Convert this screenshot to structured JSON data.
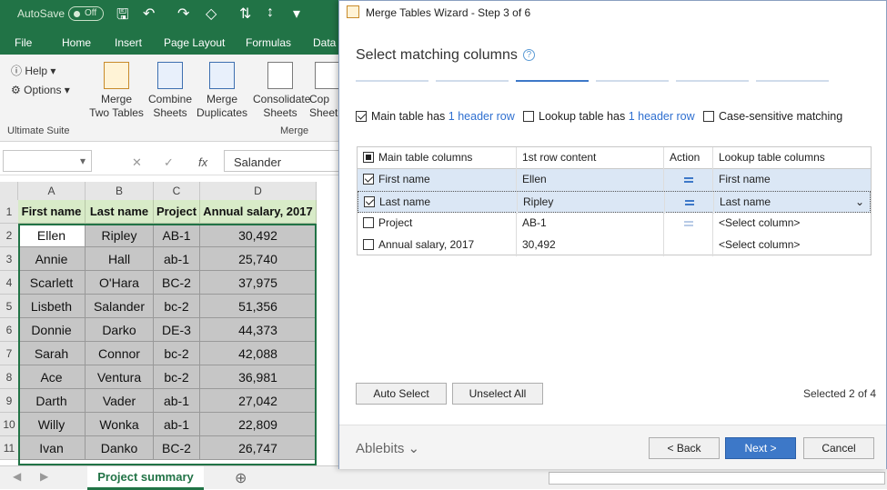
{
  "excel": {
    "autosave_label": "AutoSave",
    "autosave_state": "Off",
    "tabs": [
      "File",
      "Home",
      "Insert",
      "Page Layout",
      "Formulas",
      "Data"
    ],
    "ribbon": {
      "help_label": "Help",
      "options_label": "Options",
      "suite_label": "Ultimate Suite",
      "merge_group_label": "Merge",
      "buttons": [
        {
          "line1": "Merge",
          "line2": "Two Tables"
        },
        {
          "line1": "Combine",
          "line2": "Sheets"
        },
        {
          "line1": "Merge",
          "line2": "Duplicates"
        },
        {
          "line1": "Consolidate",
          "line2": "Sheets"
        },
        {
          "line1": "Cop",
          "line2": "Sheet"
        }
      ]
    },
    "formula": {
      "fx": "fx",
      "value": "Salander"
    },
    "columns": [
      "A",
      "B",
      "C",
      "D"
    ],
    "rows": [
      "1",
      "2",
      "3",
      "4",
      "5",
      "6",
      "7",
      "8",
      "9",
      "10",
      "11"
    ],
    "header": [
      "First name",
      "Last name",
      "Project",
      "Annual salary, 2017"
    ],
    "data": [
      [
        "Ellen",
        "Ripley",
        "AB-1",
        "30,492"
      ],
      [
        "Annie",
        "Hall",
        "ab-1",
        "25,740"
      ],
      [
        "Scarlett",
        "O'Hara",
        "BC-2",
        "37,975"
      ],
      [
        "Lisbeth",
        "Salander",
        "bc-2",
        "51,356"
      ],
      [
        "Donnie",
        "Darko",
        "DE-3",
        "44,373"
      ],
      [
        "Sarah",
        "Connor",
        "bc-2",
        "42,088"
      ],
      [
        "Ace",
        "Ventura",
        "bc-2",
        "36,981"
      ],
      [
        "Darth",
        "Vader",
        "ab-1",
        "27,042"
      ],
      [
        "Willy",
        "Wonka",
        "ab-1",
        "22,809"
      ],
      [
        "Ivan",
        "Danko",
        "BC-2",
        "26,747"
      ]
    ],
    "sheet_tab": "Project summary"
  },
  "wizard": {
    "title": "Merge Tables Wizard - Step 3 of 6",
    "heading": "Select matching columns",
    "options": {
      "main_prefix": "Main table has",
      "main_link": "1 header row",
      "lookup_prefix": "Lookup table has",
      "lookup_link": "1 header row",
      "case_label": "Case-sensitive matching"
    },
    "table": {
      "headers": [
        "Main table columns",
        "1st row content",
        "Action",
        "Lookup table columns"
      ],
      "rows": [
        {
          "main": "First name",
          "content": "Ellen",
          "lookup": "First name"
        },
        {
          "main": "Last name",
          "content": "Ripley",
          "lookup": "Last name"
        },
        {
          "main": "Project",
          "content": "AB-1",
          "lookup": "<Select column>"
        },
        {
          "main": "Annual salary, 2017",
          "content": "30,492",
          "lookup": "<Select column>"
        }
      ]
    },
    "auto_select": "Auto Select",
    "unselect_all": "Unselect All",
    "selected_count": "Selected 2 of 4",
    "brand": "Ablebits",
    "back": "< Back",
    "next": "Next >",
    "cancel": "Cancel"
  }
}
